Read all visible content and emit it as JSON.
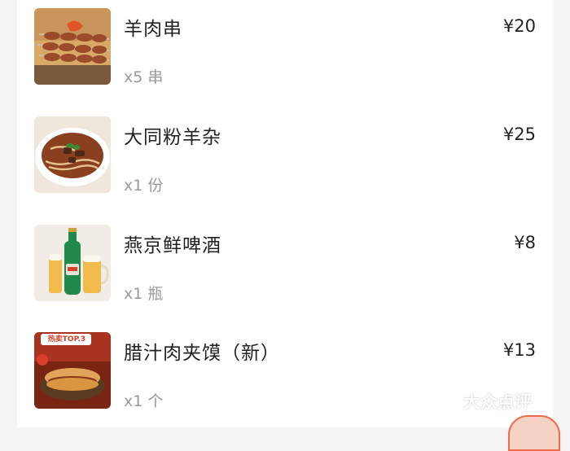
{
  "order_items": [
    {
      "name": "羊肉串",
      "qty": "x5 串",
      "price": "¥20",
      "image": "lamb-skewers-image"
    },
    {
      "name": "大同粉羊杂",
      "qty": "x1 份",
      "price": "¥25",
      "image": "lamb-offal-noodles-image"
    },
    {
      "name": "燕京鲜啤酒",
      "qty": "x1 瓶",
      "price": "¥8",
      "image": "beer-image"
    },
    {
      "name": "腊汁肉夹馍（新）",
      "qty": "x1 个",
      "price": "¥13",
      "image": "roujiamo-image",
      "image_badge": "热卖TOP.3"
    }
  ],
  "watermark": {
    "text": "大众点评"
  },
  "colors": {
    "accent": "#d8402a",
    "text": "#222222",
    "muted": "#9a9a9a"
  }
}
